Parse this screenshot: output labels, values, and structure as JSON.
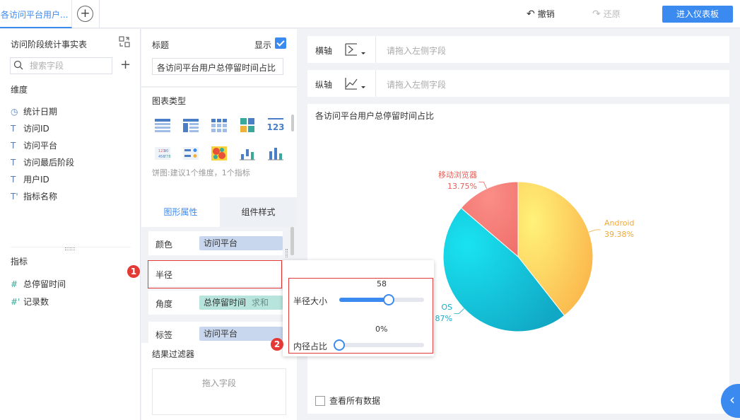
{
  "topbar": {
    "tab_label": "各访问平台用户...",
    "undo_label": "撤销",
    "redo_label": "还原",
    "enter_dashboard_label": "进入仪表板"
  },
  "left_panel": {
    "dataset_title": "访问阶段统计事实表",
    "search_placeholder": "搜索字段",
    "dimensions_title": "维度",
    "dimensions": [
      {
        "icon": "clock-icon",
        "label": "统计日期"
      },
      {
        "icon": "text-type-icon",
        "label": "访问ID"
      },
      {
        "icon": "text-type-icon",
        "label": "访问平台"
      },
      {
        "icon": "text-type-icon",
        "label": "访问最后阶段"
      },
      {
        "icon": "text-type-icon",
        "label": "用户ID"
      },
      {
        "icon": "text-calc-icon",
        "label": "指标名称"
      }
    ],
    "measures_title": "指标",
    "measures": [
      {
        "icon": "hash-icon",
        "label": "总停留时间"
      },
      {
        "icon": "hash-calc-icon",
        "label": "记录数"
      }
    ]
  },
  "middle_panel": {
    "title_label": "标题",
    "show_label": "显示",
    "show_checked": true,
    "title_value": "各访问平台用户总停留时间占比",
    "chart_type_label": "图表类型",
    "chart_type_hint": "饼图:建议1个维度，1个指标",
    "tabs": [
      {
        "label": "图形属性",
        "active": true
      },
      {
        "label": "组件样式",
        "active": false
      }
    ],
    "properties": [
      {
        "label": "颜色",
        "pill": "访问平台",
        "pill_type": "dimension"
      },
      {
        "label": "半径",
        "pill": "",
        "pill_type": ""
      },
      {
        "label": "角度",
        "pill": "总停留时间",
        "pill_sub": "求和",
        "pill_type": "measure"
      },
      {
        "label": "标签",
        "pill": "访问平台",
        "pill_type": "dimension"
      }
    ],
    "filter_title": "结果过滤器",
    "filter_placeholder": "拖入字段"
  },
  "axes": {
    "x_label": "横轴",
    "y_label": "纵轴",
    "placeholder": "请拖入左侧字段"
  },
  "chart": {
    "title": "各访问平台用户总停留时间占比",
    "see_all_label": "查看所有数据"
  },
  "chart_data": {
    "type": "pie",
    "title": "各访问平台用户总停留时间占比",
    "categories": [
      "Android",
      "iOS",
      "移动浏览器"
    ],
    "values": [
      39.38,
      46.87,
      13.75
    ],
    "labels": [
      {
        "name": "Android",
        "percent": "39.38%"
      },
      {
        "name": "OS",
        "percent": "87%"
      },
      {
        "name": "移动浏览器",
        "percent": "13.75%"
      }
    ],
    "colors": [
      "#fbc24a",
      "#10c0d6",
      "#f47c78"
    ],
    "label_colors": [
      "#f0a933",
      "#19a9c9",
      "#e8605a"
    ]
  },
  "popup": {
    "radius_value": "58",
    "radius_label": "半径大小",
    "radius_fraction": 0.58,
    "inner_value": "0%",
    "inner_label": "内径占比",
    "inner_fraction": 0
  },
  "badges": [
    "1",
    "2"
  ],
  "colors": {
    "accent": "#3b8af0",
    "highlight": "#e53935"
  }
}
